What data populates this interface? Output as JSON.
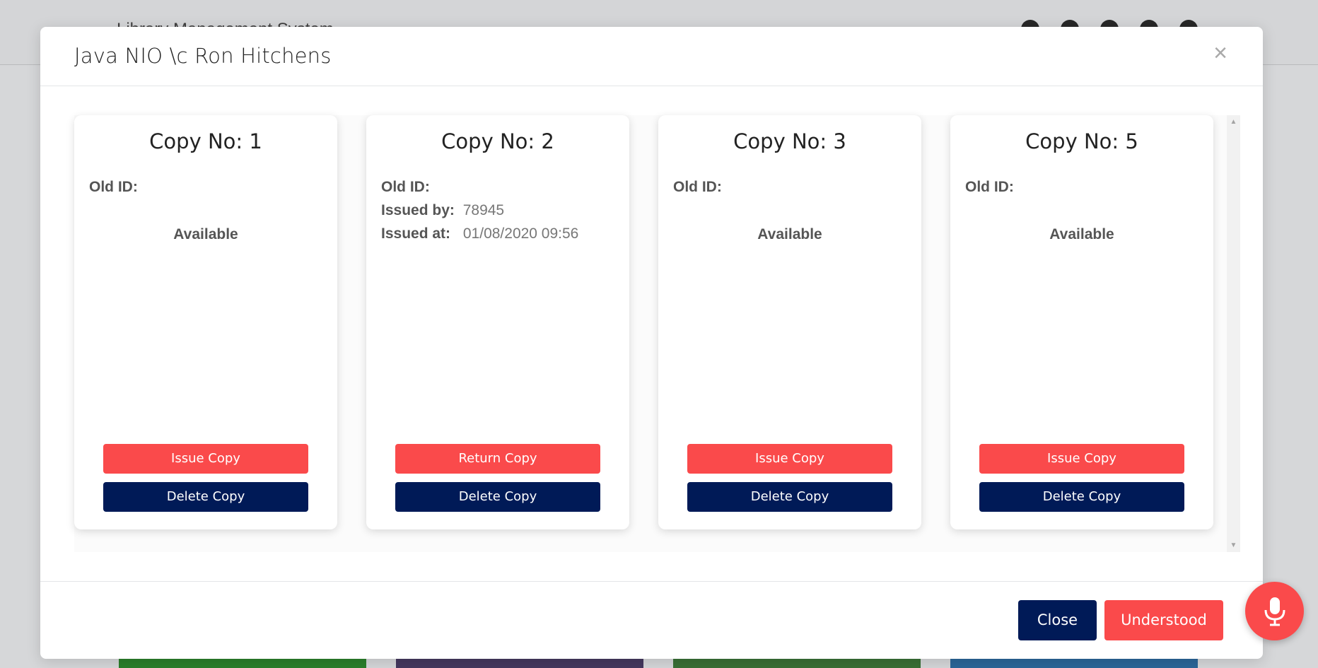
{
  "background": {
    "title": "Library Management System",
    "thumb_colors": [
      "#2f8a2f",
      "#4a3d66",
      "#3e7a3a",
      "#2f6fa6"
    ]
  },
  "modal": {
    "title": "Java NIO \\c Ron Hitchens",
    "close_symbol": "×"
  },
  "cards": [
    {
      "title": "Copy No: 1",
      "old_id_label": "Old ID:",
      "old_id_value": "",
      "status": "Available",
      "action_label": "Issue Copy",
      "delete_label": "Delete Copy"
    },
    {
      "title": "Copy No: 2",
      "old_id_label": "Old ID:",
      "old_id_value": "",
      "issued_by_label": "Issued by:",
      "issued_by_value": "78945",
      "issued_at_label": "Issued at:",
      "issued_at_value": "01/08/2020 09:56",
      "action_label": "Return Copy",
      "delete_label": "Delete Copy"
    },
    {
      "title": "Copy No: 3",
      "old_id_label": "Old ID:",
      "old_id_value": "",
      "status": "Available",
      "action_label": "Issue Copy",
      "delete_label": "Delete Copy"
    },
    {
      "title": "Copy No: 5",
      "old_id_label": "Old ID:",
      "old_id_value": "",
      "status": "Available",
      "action_label": "Issue Copy",
      "delete_label": "Delete Copy"
    }
  ],
  "footer": {
    "close_label": "Close",
    "understood_label": "Understood"
  },
  "colors": {
    "primary_red": "#fa4a4b",
    "navy": "#001a57"
  },
  "icons": {
    "mic": "microphone-icon",
    "close": "close-icon",
    "scroll_up": "arrow-up-icon",
    "scroll_down": "arrow-down-icon"
  }
}
